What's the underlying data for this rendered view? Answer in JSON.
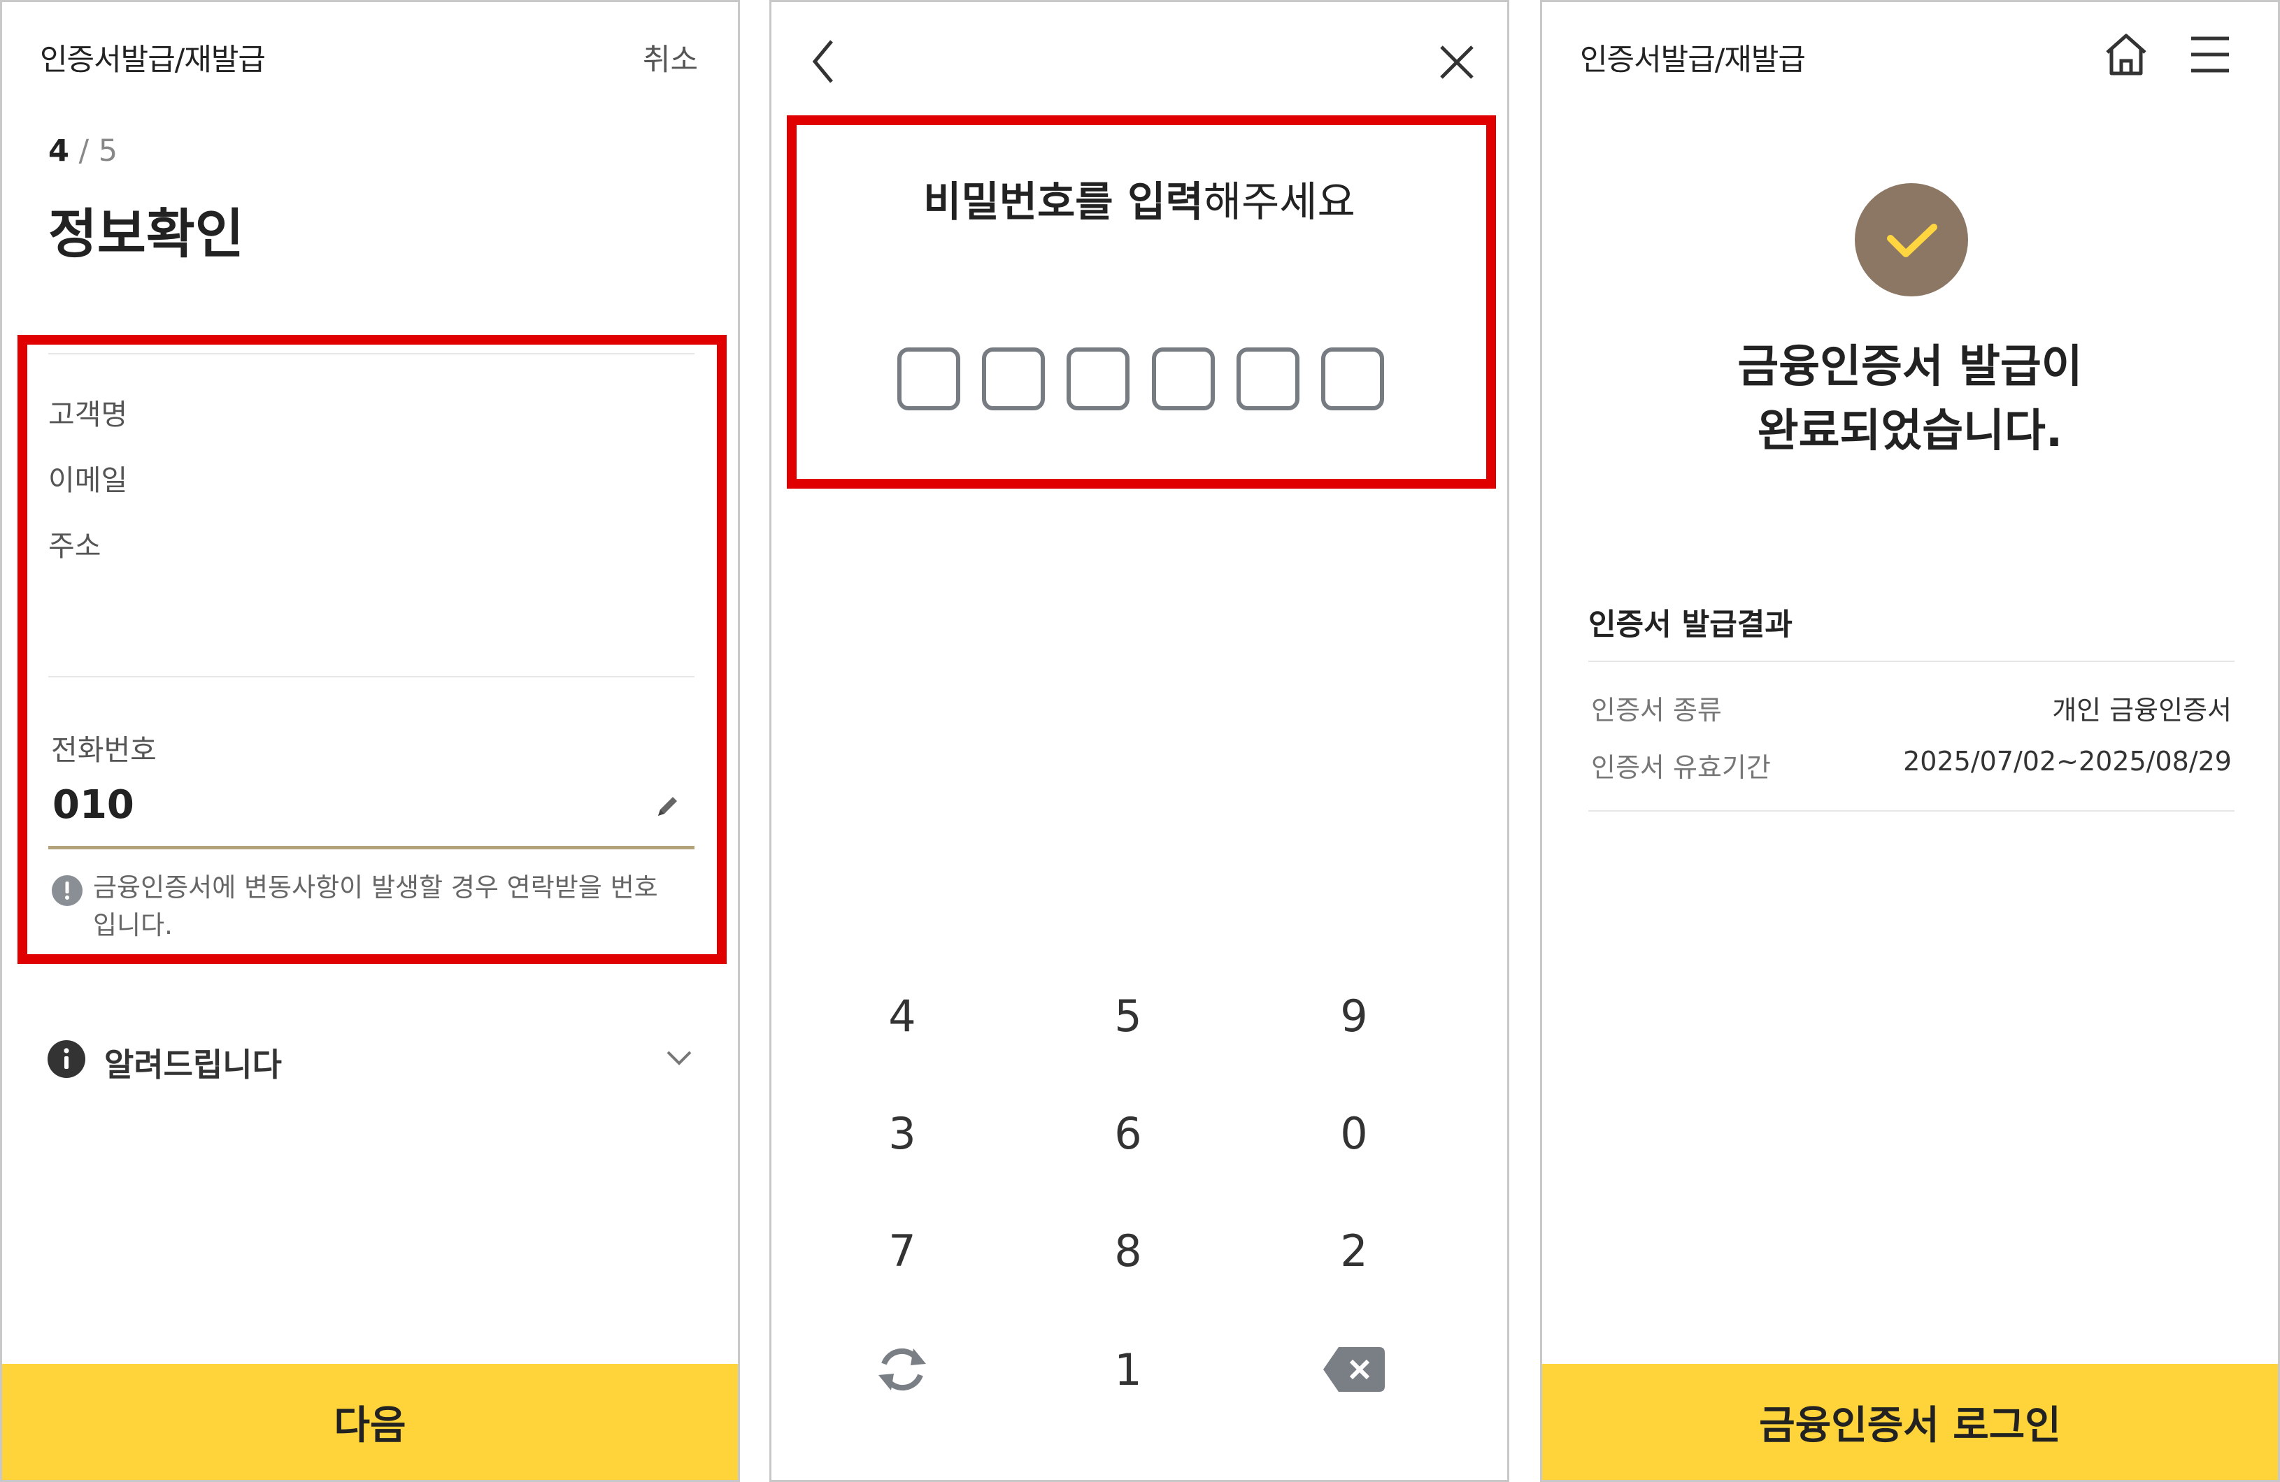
{
  "panel1": {
    "header_title": "인증서발급/재발급",
    "cancel_label": "취소",
    "step_current": "4",
    "step_total": "5",
    "page_title": "정보확인",
    "fields": {
      "customer_name_label": "고객명",
      "email_label": "이메일",
      "address_label": "주소"
    },
    "phone": {
      "label": "전화번호",
      "value": "010"
    },
    "notice": "금융인증서에 변동사항이 발생할 경우 연락받을 번호입니다.",
    "info_section": "알려드립니다",
    "next_button": "다음"
  },
  "panel2": {
    "prompt_bold": "비밀번호를 입력",
    "prompt_regular": "해주세요",
    "pin_length": 6,
    "keypad": {
      "r1": [
        "4",
        "5",
        "9"
      ],
      "r2": [
        "3",
        "6",
        "0"
      ],
      "r3": [
        "7",
        "8",
        "2"
      ],
      "r4_middle": "1"
    }
  },
  "panel3": {
    "header_title": "인증서발급/재발급",
    "success_line1": "금융인증서 발급이",
    "success_line2": "완료되었습니다.",
    "result_title": "인증서 발급결과",
    "rows": [
      {
        "label": "인증서 종류",
        "value": "개인 금융인증서"
      },
      {
        "label": "인증서 유효기간",
        "value": "2025/07/02~2025/08/29"
      }
    ],
    "login_button": "금융인증서 로그인"
  },
  "colors": {
    "accent_yellow": "#fed43a",
    "highlight_red": "#e00000",
    "check_circle": "#8b7764",
    "check_mark": "#ffd640",
    "underline_gold": "#b3a27a"
  },
  "icons": [
    "edit-pencil-icon",
    "alert-icon",
    "info-icon",
    "chevron-down-icon",
    "back-arrow-icon",
    "close-icon",
    "refresh-icon",
    "backspace-icon",
    "home-icon",
    "menu-icon",
    "check-icon"
  ]
}
